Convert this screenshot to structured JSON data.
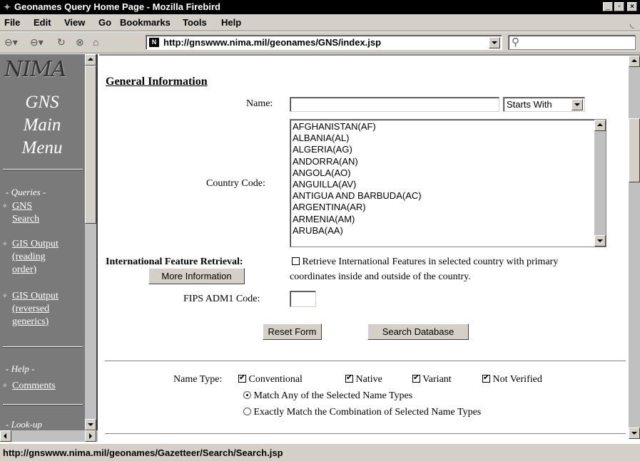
{
  "window": {
    "title": "Geonames Query Home Page - Mozilla Firebird"
  },
  "menu": {
    "items": [
      {
        "label": "File"
      },
      {
        "label": "Edit"
      },
      {
        "label": "View"
      },
      {
        "label": "Go"
      },
      {
        "label": "Bookmarks"
      },
      {
        "label": "Tools"
      },
      {
        "label": "Help"
      }
    ]
  },
  "toolbar": {
    "url": "http://gnswww.nima.mil/geonames/GNS/index.jsp",
    "icons": [
      "back-icon",
      "forward-icon",
      "reload-icon",
      "stop-icon",
      "home-icon"
    ]
  },
  "sidebar": {
    "logo": "NIMA",
    "title_lines": [
      "GNS",
      "Main",
      "Menu"
    ],
    "queries_heading": "- Queries -",
    "links": [
      {
        "lines": [
          "GNS",
          "Search"
        ]
      },
      {
        "lines": [
          "GIS Output",
          "(reading",
          "order)"
        ]
      },
      {
        "lines": [
          "GIS Output",
          "(reversed",
          "generics)"
        ]
      }
    ],
    "help_heading": "- Help -",
    "comments_link": "Comments",
    "lookup_heading": "- Look-up"
  },
  "form": {
    "section_title": "General Information",
    "name_label": "Name:",
    "name_value": "",
    "name_mode": "Starts With",
    "country_label": "Country Code:",
    "countries": [
      "AFGHANISTAN(AF)",
      "ALBANIA(AL)",
      "ALGERIA(AG)",
      "ANDORRA(AN)",
      "ANGOLA(AO)",
      "ANGUILLA(AV)",
      "ANTIGUA AND BARBUDA(AC)",
      "ARGENTINA(AR)",
      "ARMENIA(AM)",
      "ARUBA(AA)"
    ],
    "intl_label": "International Feature Retrieval:",
    "intl_checkbox_line1": "Retrieve International Features in selected country with primary",
    "intl_checkbox_line2": "coordinates inside and outside of the country.",
    "more_info_button": "More Information",
    "fips_label": "FIPS ADM1 Code:",
    "fips_value": "",
    "reset_button": "Reset Form",
    "search_button": "Search Database",
    "name_type_label": "Name Type:",
    "name_types": [
      "Conventional",
      "Native",
      "Variant",
      "Not Verified"
    ],
    "match_any": "Match Any of the Selected Name Types",
    "match_exact": "Exactly Match the Combination of Selected Name Types"
  },
  "status": {
    "text": "http://gnswww.nima.mil/geonames/Gazetteer/Search/Search.jsp"
  }
}
